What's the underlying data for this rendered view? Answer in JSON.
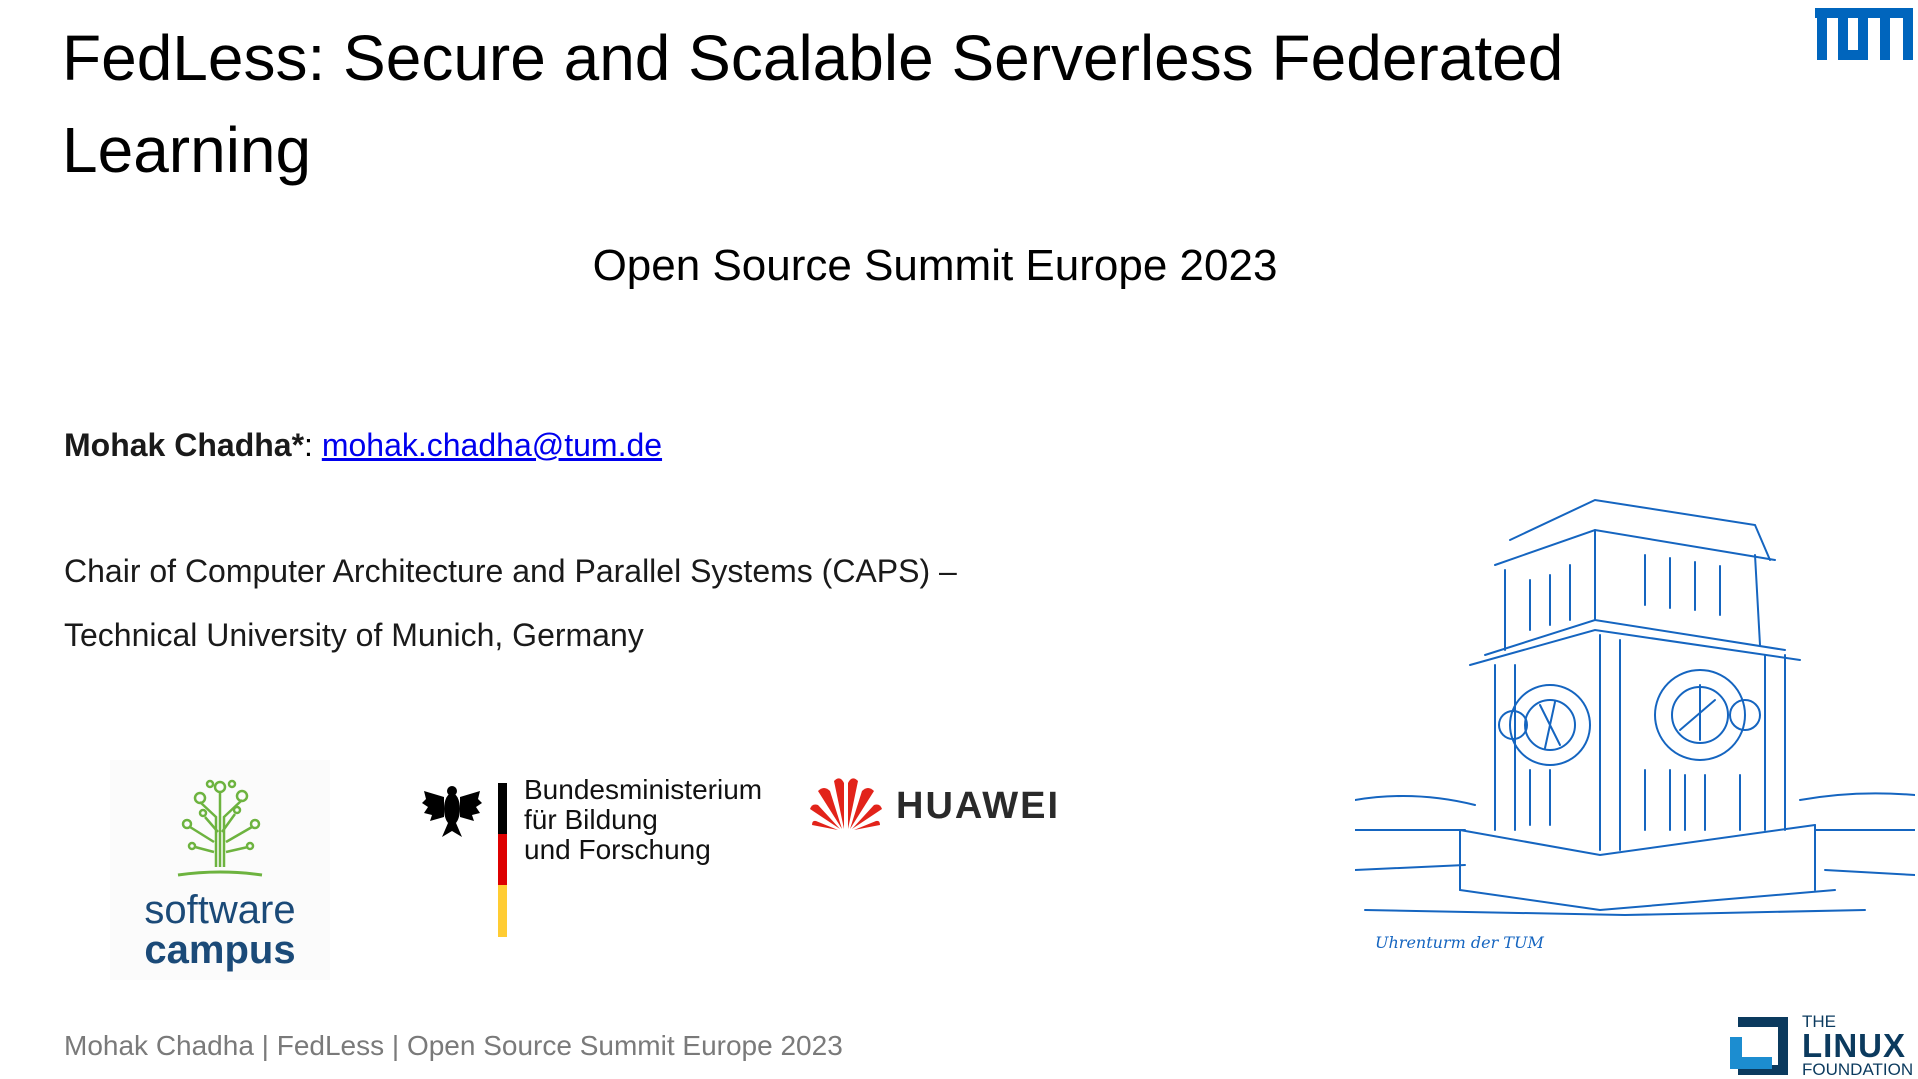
{
  "slide": {
    "title": "FedLess: Secure and Scalable Serverless Federated Learning",
    "subtitle": "Open Source Summit Europe 2023",
    "author": {
      "name": "Mohak Chadha*",
      "separator": ": ",
      "email": "mohak.chadha@tum.de"
    },
    "affiliation": {
      "line1": "Chair of Computer Architecture and Parallel Systems (CAPS) –",
      "line2": "Technical University of Munich, Germany"
    },
    "footer": "Mohak Chadha | FedLess | Open Source Summit Europe 2023"
  },
  "logos": {
    "tum": {
      "label": "TUM",
      "color": "#0065bd"
    },
    "software_campus": {
      "line1": "software",
      "line2": "campus",
      "text_color": "#1b4a78",
      "tree_color": "#6db33f"
    },
    "bmbf": {
      "line1": "Bundesministerium",
      "line2": "für Bildung",
      "line3": "und Forschung"
    },
    "huawei": {
      "label": "HUAWEI",
      "flower_color": "#e2231a"
    },
    "linux_foundation": {
      "line1": "THE",
      "line2": "LINUX",
      "line3": "FOUNDATION",
      "dark": "#0b3a5e",
      "light": "#1c8dd0"
    }
  },
  "illustration": {
    "caption": "Uhrenturm der TUM",
    "stroke_color": "#1565c0"
  }
}
